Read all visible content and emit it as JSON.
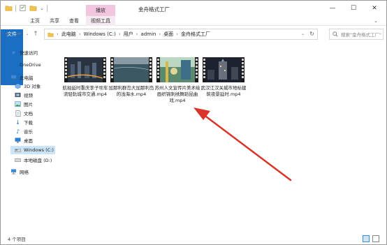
{
  "window": {
    "title": "金舟格式工厂",
    "context_tab": "播放",
    "buttons": {
      "minimize": "—",
      "maximize": "☐",
      "close": "✕"
    }
  },
  "ribbon": {
    "tabs": [
      "文件",
      "主页",
      "共享",
      "查看",
      "视频工具"
    ],
    "expand": "⌄"
  },
  "address": {
    "crumbs": [
      "此电脑",
      "Windows (C:)",
      "用户",
      "admin",
      "桌面",
      "金舟格式工厂"
    ],
    "search_placeholder": "搜索\"金舟格式工厂\""
  },
  "sidebar": {
    "items": [
      {
        "label": "快速访问",
        "icon": "star-icon"
      },
      {
        "label": "OneDrive",
        "icon": "cloud-icon"
      },
      {
        "label": "此电脑",
        "icon": "computer-icon"
      },
      {
        "label": "3D 对象",
        "icon": "cube-icon"
      },
      {
        "label": "视频",
        "icon": "video-icon"
      },
      {
        "label": "图片",
        "icon": "picture-icon"
      },
      {
        "label": "文档",
        "icon": "document-icon"
      },
      {
        "label": "下载",
        "icon": "download-icon"
      },
      {
        "label": "音乐",
        "icon": "music-icon"
      },
      {
        "label": "桌面",
        "icon": "desktop-icon"
      },
      {
        "label": "Windows (C:)",
        "icon": "drive-icon",
        "selected": true
      },
      {
        "label": "本地磁盘 (D:)",
        "icon": "drive-icon"
      },
      {
        "label": "网络",
        "icon": "network-icon"
      }
    ]
  },
  "files": [
    {
      "name": "航拍延时重庆李子坝车流轻轨城市交通.mp4",
      "thumb": "city-night"
    },
    {
      "name": "加那利群岛大加那利岛的浅海水.mp4",
      "thumb": "sea"
    },
    {
      "name": "苏州人文宣传片美术绘画织锦刺绣舞蹈昆曲戏.mp4",
      "thumb": "art"
    },
    {
      "name": "武汉江汉关城市地标建筑夜景延时.mp4",
      "thumb": "night-landmark"
    }
  ],
  "status": {
    "count": "4 个项目"
  },
  "colors": {
    "accent": "#1a6fc4",
    "context_tab": "#f3c6e0",
    "selected": "#cce4f7",
    "annotation_arrow": "#d9342b"
  }
}
